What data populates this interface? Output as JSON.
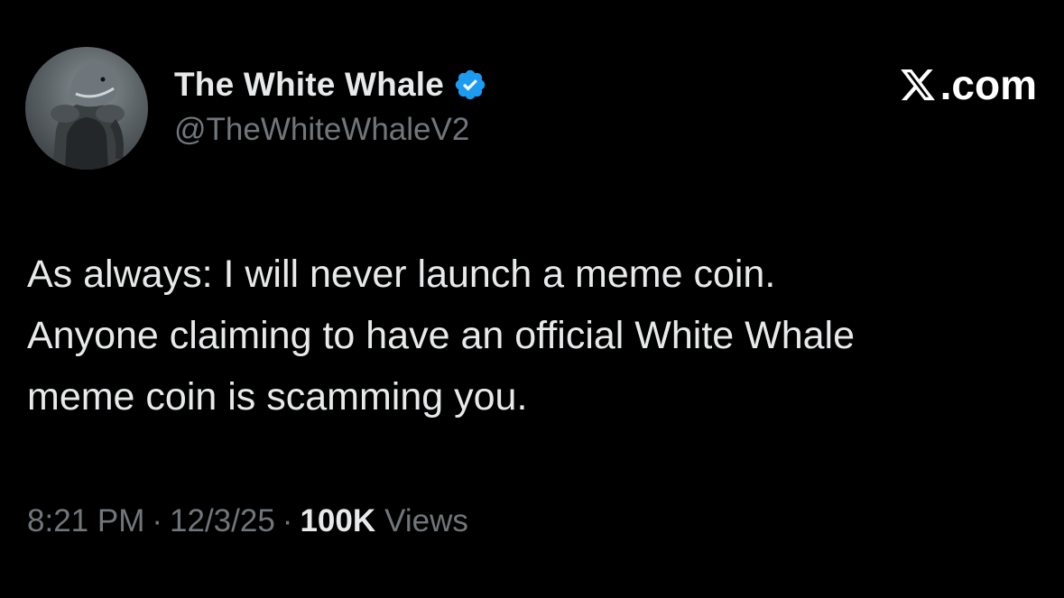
{
  "author": {
    "display_name": "The White Whale",
    "handle": "@TheWhiteWhaleV2",
    "verified": true,
    "avatar_icon": "whale-knight-avatar"
  },
  "brand": {
    "logo_icon": "x-logo-icon",
    "text": ".com"
  },
  "post": {
    "lines": [
      "As always: I will never launch a meme coin.",
      "Anyone claiming to have an official White Whale",
      "meme coin is scamming you."
    ],
    "time": "8:21 PM",
    "date": "12/3/25",
    "separator": "·",
    "views_count": "100K",
    "views_label": "Views"
  },
  "colors": {
    "background": "#000000",
    "primary_text": "#e7e9ea",
    "secondary_text": "#71767b",
    "verified_badge": "#1d9bf0"
  }
}
